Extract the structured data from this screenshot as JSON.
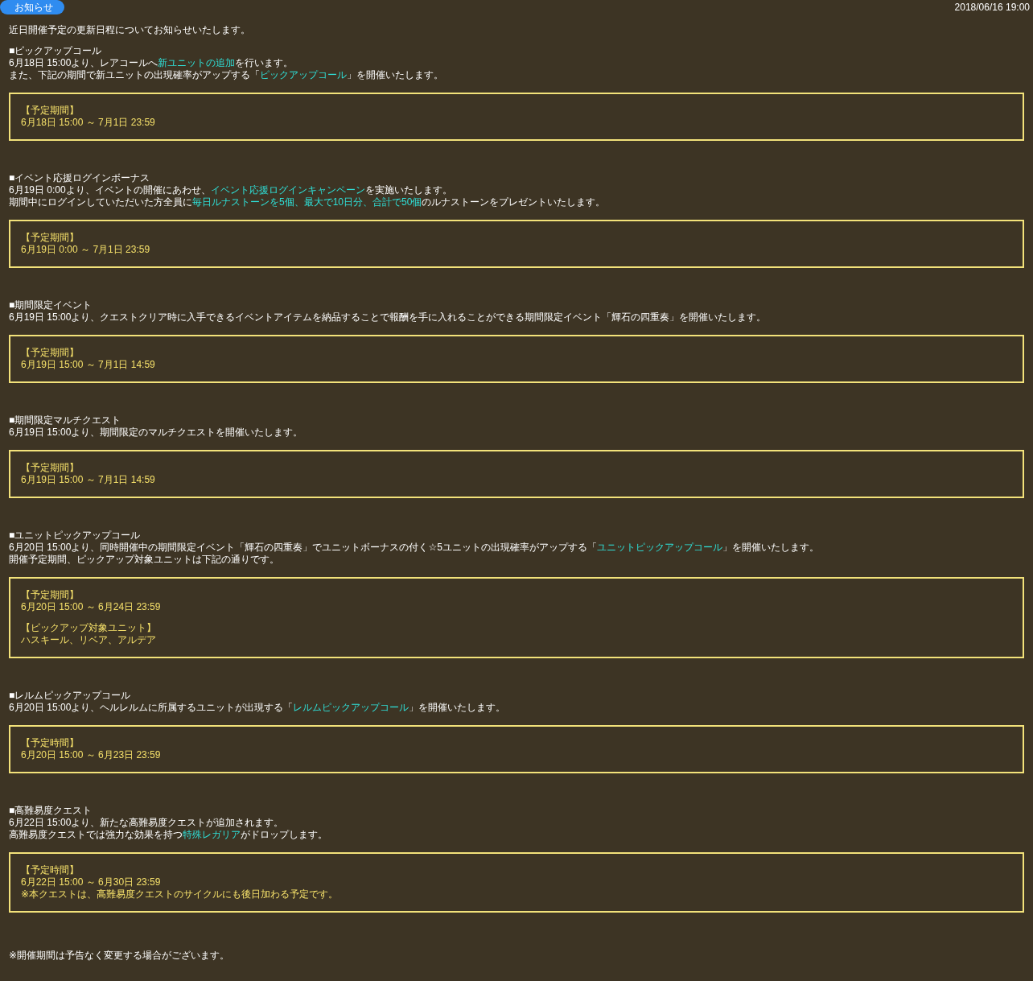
{
  "header": {
    "badge": "お知らせ",
    "date": "2018/06/16 19:00"
  },
  "intro": "近日開催予定の更新日程についてお知らせいたします。",
  "sections": [
    {
      "title": "■ピックアップコール",
      "lines": [
        [
          {
            "text": "6月18日 15:00より、レアコールへ",
            "highlight": false
          },
          {
            "text": "新ユニットの追加",
            "highlight": true
          },
          {
            "text": "を行います。",
            "highlight": false
          }
        ],
        [
          {
            "text": "また、下記の期間で新ユニットの出現確率がアップする「",
            "highlight": false
          },
          {
            "text": "ピックアップコール",
            "highlight": true
          },
          {
            "text": "」を開催いたします。",
            "highlight": false
          }
        ]
      ],
      "box": [
        {
          "heading": "【予定期間】",
          "lines": [
            "6月18日 15:00 ～ 7月1日 23:59"
          ]
        }
      ]
    },
    {
      "title": "■イベント応援ログインボーナス",
      "lines": [
        [
          {
            "text": "6月19日 0:00より、イベントの開催にあわせ、",
            "highlight": false
          },
          {
            "text": "イベント応援ログインキャンペーン",
            "highlight": true
          },
          {
            "text": "を実施いたします。",
            "highlight": false
          }
        ],
        [
          {
            "text": "期間中にログインしていただいた方全員に",
            "highlight": false
          },
          {
            "text": "毎日ルナストーンを5個、最大で10日分、合計で50個",
            "highlight": true
          },
          {
            "text": "のルナストーンをプレゼントいたします。",
            "highlight": false
          }
        ]
      ],
      "box": [
        {
          "heading": "【予定期間】",
          "lines": [
            "6月19日 0:00 ～ 7月1日 23:59"
          ]
        }
      ]
    },
    {
      "title": "■期間限定イベント",
      "lines": [
        [
          {
            "text": "6月19日 15:00より、クエストクリア時に入手できるイベントアイテムを納品することで報酬を手に入れることができる期間限定イベント「輝石の四重奏」を開催いたします。",
            "highlight": false
          }
        ]
      ],
      "box": [
        {
          "heading": "【予定期間】",
          "lines": [
            "6月19日 15:00 ～ 7月1日 14:59"
          ]
        }
      ]
    },
    {
      "title": "■期間限定マルチクエスト",
      "lines": [
        [
          {
            "text": "6月19日 15:00より、期間限定のマルチクエストを開催いたします。",
            "highlight": false
          }
        ]
      ],
      "box": [
        {
          "heading": "【予定期間】",
          "lines": [
            "6月19日 15:00 ～ 7月1日 14:59"
          ]
        }
      ]
    },
    {
      "title": "■ユニットピックアップコール",
      "lines": [
        [
          {
            "text": "6月20日 15:00より、同時開催中の期間限定イベント「輝石の四重奏」でユニットボーナスの付く☆5ユニットの出現確率がアップする「",
            "highlight": false
          },
          {
            "text": "ユニットピックアップコール",
            "highlight": true
          },
          {
            "text": "」を開催いたします。",
            "highlight": false
          }
        ],
        [
          {
            "text": "開催予定期間、ピックアップ対象ユニットは下記の通りです。",
            "highlight": false
          }
        ]
      ],
      "box": [
        {
          "heading": "【予定期間】",
          "lines": [
            "6月20日 15:00 ～ 6月24日 23:59"
          ]
        },
        {
          "heading": "【ピックアップ対象ユニット】",
          "lines": [
            "ハスキール、リベア、アルデア"
          ]
        }
      ]
    },
    {
      "title": "■レルムピックアップコール",
      "lines": [
        [
          {
            "text": "6月20日 15:00より、ヘルレルムに所属するユニットが出現する「",
            "highlight": false
          },
          {
            "text": "レルムピックアップコール",
            "highlight": true
          },
          {
            "text": "」を開催いたします。",
            "highlight": false
          }
        ]
      ],
      "box": [
        {
          "heading": "【予定時間】",
          "lines": [
            "6月20日 15:00 ～ 6月23日 23:59"
          ]
        }
      ]
    },
    {
      "title": "■高難易度クエスト",
      "lines": [
        [
          {
            "text": "6月22日 15:00より、新たな高難易度クエストが追加されます。",
            "highlight": false
          }
        ],
        [
          {
            "text": "高難易度クエストでは強力な効果を持つ",
            "highlight": false
          },
          {
            "text": "特殊レガリア",
            "highlight": true
          },
          {
            "text": "がドロップします。",
            "highlight": false
          }
        ]
      ],
      "box": [
        {
          "heading": "【予定時間】",
          "lines": [
            "6月22日 15:00 ～ 6月30日 23:59",
            "※本クエストは、高難易度クエストのサイクルにも後日加わる予定です。"
          ]
        }
      ]
    }
  ],
  "footnote": "※開催期間は予告なく変更する場合がございます。"
}
